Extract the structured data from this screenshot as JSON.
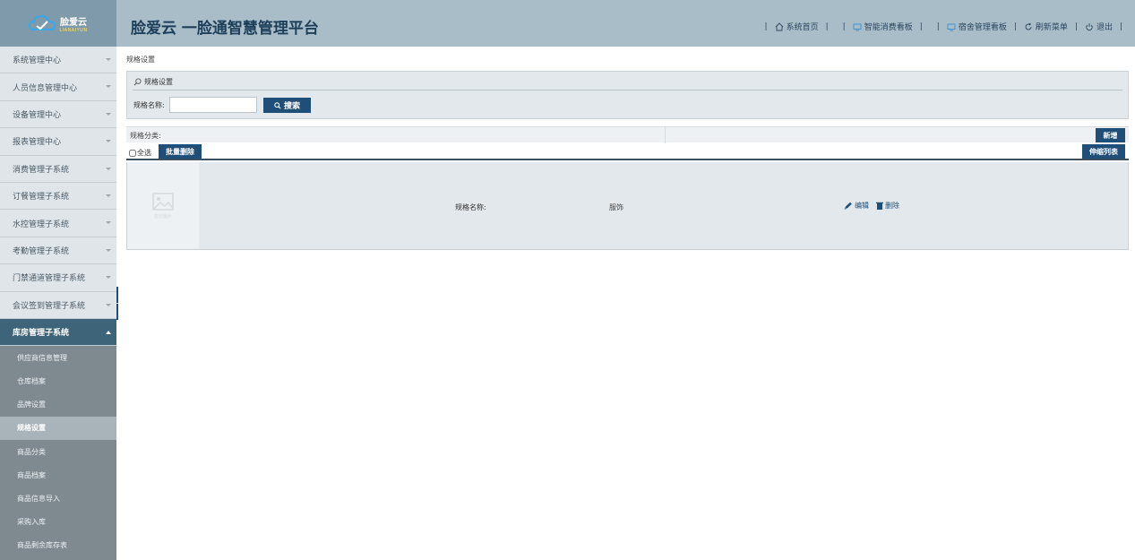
{
  "header": {
    "logo_name": "脸爱云",
    "logo_sub": "LIANAIYUN",
    "title": "脸爱云 一脸通智慧管理平台",
    "nav": [
      {
        "label": "系统首页",
        "icon": "home-icon"
      },
      {
        "label": "智能消费看板",
        "icon": "monitor-icon"
      },
      {
        "label": "宿舍管理看板",
        "icon": "monitor-icon"
      },
      {
        "label": "刷新菜单",
        "icon": "refresh-icon"
      },
      {
        "label": "退出",
        "icon": "power-icon"
      }
    ]
  },
  "sidebar": {
    "menus": [
      "系统管理中心",
      "人员信息管理中心",
      "设备管理中心",
      "报表管理中心",
      "消费管理子系统",
      "订餐管理子系统",
      "水控管理子系统",
      "考勤管理子系统",
      "门禁通道管理子系统",
      "会议签到管理子系统"
    ],
    "active_menu": "库房管理子系统",
    "sub_items": [
      "供应商信息管理",
      "仓库档案",
      "品牌设置",
      "规格设置",
      "商品分类",
      "商品档案",
      "商品信息导入",
      "采购入库",
      "商品剩余库存表"
    ]
  },
  "main": {
    "breadcrumb": "规格设置",
    "search_title": "规格设置",
    "search_label": "规格名称:",
    "search_value": "",
    "search_button": "搜索",
    "category_label": "规格分类:",
    "add_button": "新增",
    "select_all": "全选",
    "batch_delete": "批量删除",
    "toggle_list": "伸缩列表",
    "thumb_text": "暂无图片",
    "row": {
      "label": "规格名称:",
      "value": "服饰",
      "edit": "编辑",
      "delete": "删除"
    }
  },
  "colors": {
    "header_bg": "#a9bdc8",
    "logo_bg": "#7f9aaa",
    "primary": "#1f4e79",
    "active_menu_bg": "#3e6479",
    "sidebar_bg": "#7f8a90"
  }
}
